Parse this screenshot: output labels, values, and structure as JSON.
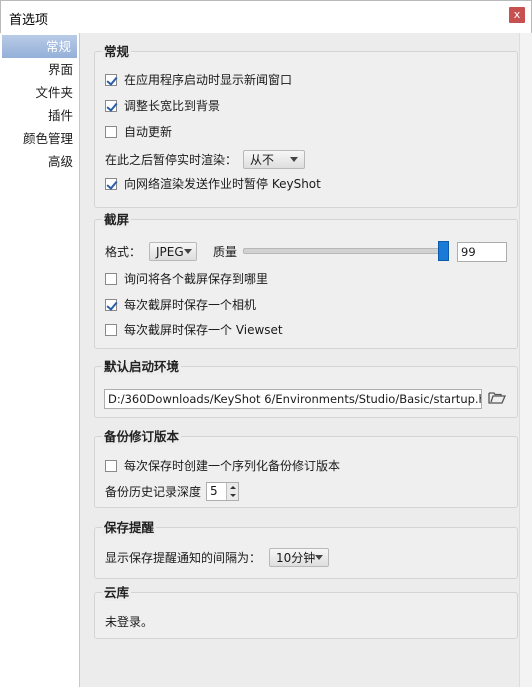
{
  "window": {
    "title": "首选项",
    "close_glyph": "x"
  },
  "sidebar": {
    "items": [
      {
        "label": "常规",
        "active": true
      },
      {
        "label": "界面"
      },
      {
        "label": "文件夹"
      },
      {
        "label": "插件"
      },
      {
        "label": "颜色管理"
      },
      {
        "label": "高级"
      }
    ]
  },
  "general": {
    "title": "常规",
    "show_news": "在应用程序启动时显示新闻窗口",
    "show_news_checked": true,
    "adjust_aspect": "调整长宽比到背景",
    "adjust_aspect_checked": true,
    "auto_update": "自动更新",
    "auto_update_checked": false,
    "pause_label": "在此之后暂停实时渲染：",
    "pause_value": "从不",
    "pause_network": "向网络渲染发送作业时暂停 KeyShot",
    "pause_network_checked": true
  },
  "screenshot": {
    "title": "截屏",
    "format_label": "格式：",
    "format_value": "JPEG",
    "quality_label": "质量",
    "quality_value": "99",
    "ask_save": "询问将各个截屏保存到哪里",
    "ask_save_checked": false,
    "save_camera": "每次截屏时保存一个相机",
    "save_camera_checked": true,
    "save_viewset": "每次截屏时保存一个 Viewset",
    "save_viewset_checked": false
  },
  "startup": {
    "title": "默认启动环境",
    "path": "D:/360Downloads/KeyShot 6/Environments/Studio/Basic/startup.hdr",
    "folder_icon": "folder-open-icon"
  },
  "backup": {
    "title": "备份修订版本",
    "create_backup": "每次保存时创建一个序列化备份修订版本",
    "create_backup_checked": false,
    "depth_label": "备份历史记录深度",
    "depth_value": "5"
  },
  "reminder": {
    "title": "保存提醒",
    "interval_label": "显示保存提醒通知的间隔为：",
    "interval_value": "10分钟"
  },
  "cloud": {
    "title": "云库",
    "status": "未登录。"
  },
  "colors": {
    "accent": "#1a7ad8",
    "selected_sidebar": "#94afd9",
    "close": "#c75050"
  }
}
